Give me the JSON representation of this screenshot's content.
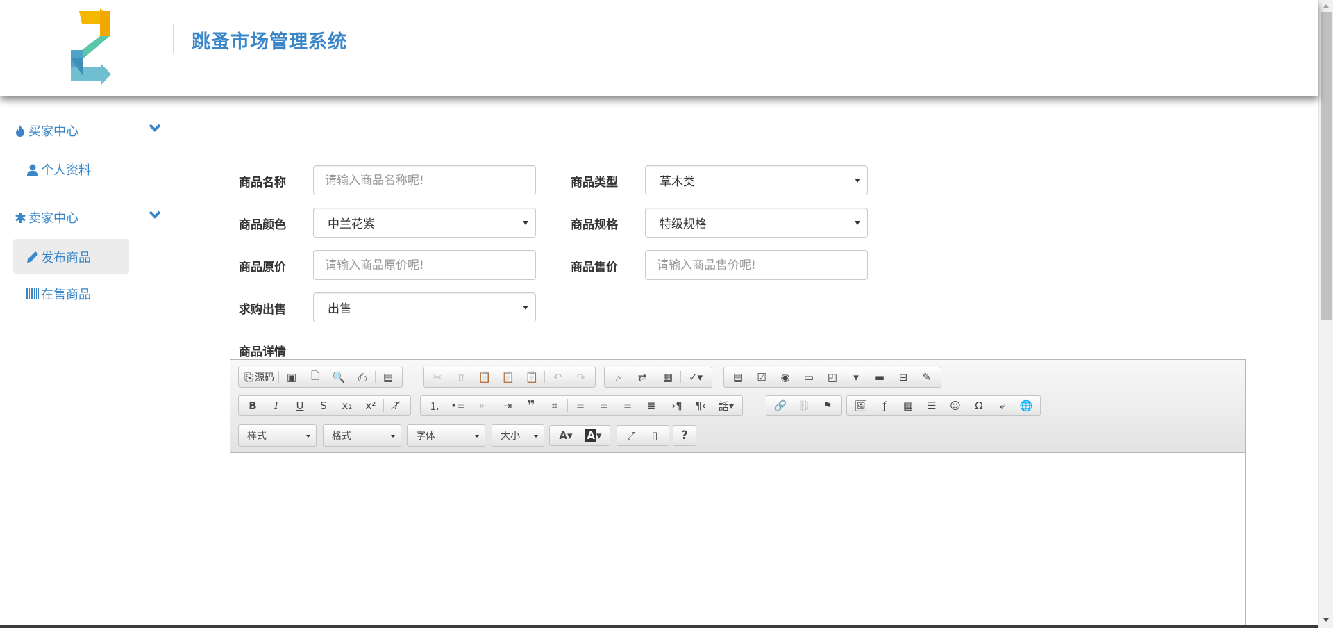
{
  "header": {
    "title": "跳蚤市场管理系统"
  },
  "sidebar": {
    "groups": [
      {
        "label": "买家中心",
        "icon": "fire-icon",
        "items": [
          {
            "label": "个人资料",
            "icon": "user-icon"
          }
        ]
      },
      {
        "label": "卖家中心",
        "icon": "asterisk-icon",
        "items": [
          {
            "label": "发布商品",
            "icon": "pencil-icon",
            "active": true
          },
          {
            "label": "在售商品",
            "icon": "barcode-icon"
          }
        ]
      }
    ]
  },
  "form": {
    "name": {
      "label": "商品名称",
      "placeholder": "请输入商品名称呢!",
      "value": ""
    },
    "type": {
      "label": "商品类型",
      "value": "草木类"
    },
    "color": {
      "label": "商品颜色",
      "value": "中兰花紫"
    },
    "spec": {
      "label": "商品规格",
      "value": "特级规格"
    },
    "orig_price": {
      "label": "商品原价",
      "placeholder": "请输入商品原价呢!",
      "value": ""
    },
    "sale_price": {
      "label": "商品售价",
      "placeholder": "请输入商品售价呢!",
      "value": ""
    },
    "trade": {
      "label": "求购出售",
      "value": "出售"
    },
    "detail": {
      "label": "商品详情"
    }
  },
  "editor": {
    "source_label": "源码",
    "combos": {
      "styles": "样式",
      "format": "格式",
      "font": "字体",
      "size": "大小"
    },
    "help": "?",
    "lang": "話",
    "accent": "#3a86c8"
  }
}
